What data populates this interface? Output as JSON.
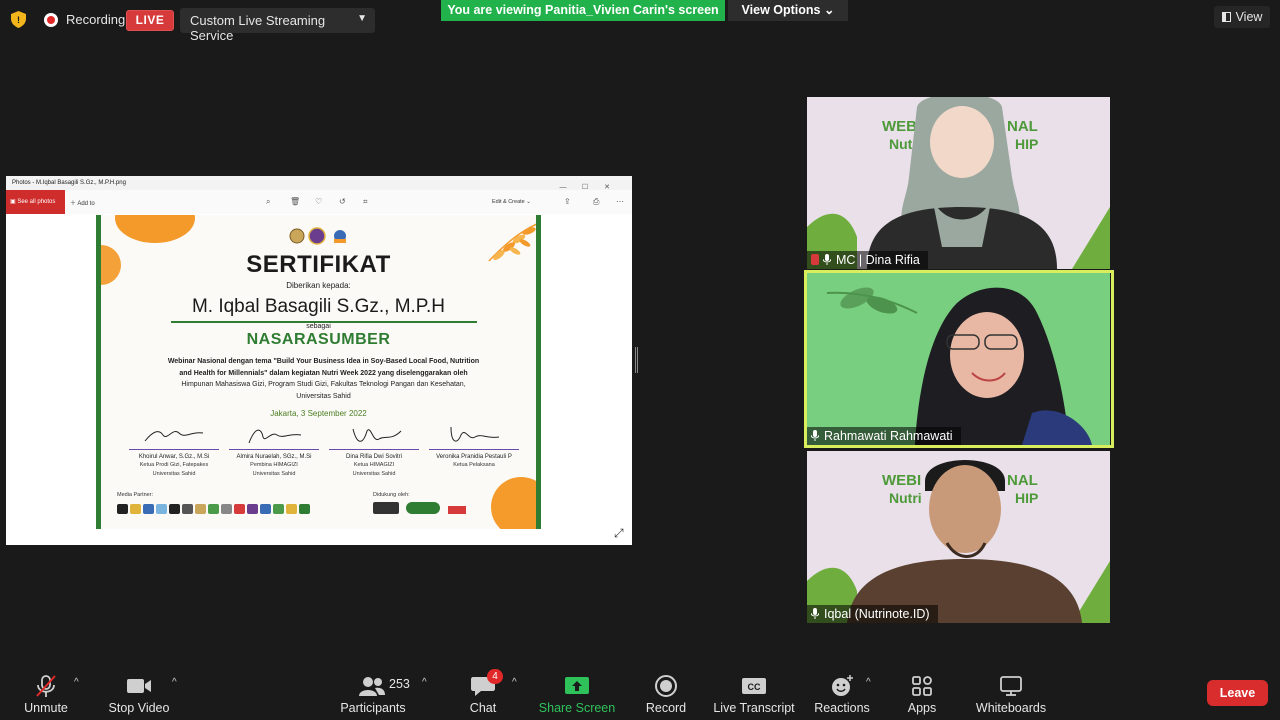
{
  "top_bar": {
    "recording_label": "Recording",
    "live_label": "LIVE",
    "stream_service": "Custom Live Streaming Service",
    "viewing_banner": "You are viewing Panitia_Vivien Carin's screen",
    "view_options": "View Options ⌄",
    "view_label": "View"
  },
  "shared_screen": {
    "window_title": "Photos - M.Iqbal Basagili S.Gz., M.P.H.png",
    "see_all_photos": "See all photos",
    "add_to": "Add to",
    "edit_create": "Edit & Create ⌄",
    "certificate": {
      "title": "SERTIFIKAT",
      "given_to": "Diberikan kepada:",
      "recipient": "M. Iqbal Basagili S.Gz., M.P.H",
      "as": "sebagai",
      "role": "NASARASUMBER",
      "body_1": "Webinar Nasional dengan tema \"Build Your Business Idea in Soy-Based Local Food, Nutrition",
      "body_2": "and Health for Millennials\" dalam kegiatan Nutri Week 2022 yang diselenggarakan oleh",
      "body_3": "Himpunan Mahasiswa Gizi, Program Studi Gizi, Fakultas Teknologi Pangan dan Kesehatan,",
      "body_4": "Universitas Sahid",
      "date": "Jakarta, 3 September 2022",
      "signatories": [
        {
          "name": "Khoirul Anwar, S.Gz., M.Si",
          "position_1": "Ketua Prodi Gizi, Fatepakes",
          "position_2": "Universitas Sahid"
        },
        {
          "name": "Almira Nuraelah, SGz., M.Si",
          "position_1": "Pembina HIMAGIZI",
          "position_2": "Universitas Sahid"
        },
        {
          "name": "Dina Rifia Dwi Sovitri",
          "position_1": "Ketua HIMAGIZI",
          "position_2": "Universitas Sahid"
        },
        {
          "name": "Veronika Pranidia Pestauli P",
          "position_1": "Ketua Pelaksana",
          "position_2": ""
        }
      ],
      "media_partner_label": "Media Partner:",
      "supported_by_label": "Didukung oleh:"
    }
  },
  "participants_video": [
    {
      "name": "MC | Dina Rifia",
      "bg": "#e9e0e9"
    },
    {
      "name": "Rahmawati Rahmawati",
      "bg": "#6fc87a"
    },
    {
      "name": "Iqbal (Nutrinote.ID)",
      "bg": "#e9e0e9"
    }
  ],
  "bottom_bar": {
    "unmute": "Unmute",
    "stop_video": "Stop Video",
    "participants": "Participants",
    "participant_count": "253",
    "chat": "Chat",
    "chat_badge": "4",
    "share_screen": "Share Screen",
    "record": "Record",
    "live_transcript": "Live Transcript",
    "reactions": "Reactions",
    "apps": "Apps",
    "whiteboards": "Whiteboards",
    "leave": "Leave"
  },
  "colors": {
    "accent_green": "#22b24c",
    "active_speaker": "#d9ee5c",
    "leave_red": "#d92c2c",
    "certificate_green": "#2f7d32"
  }
}
